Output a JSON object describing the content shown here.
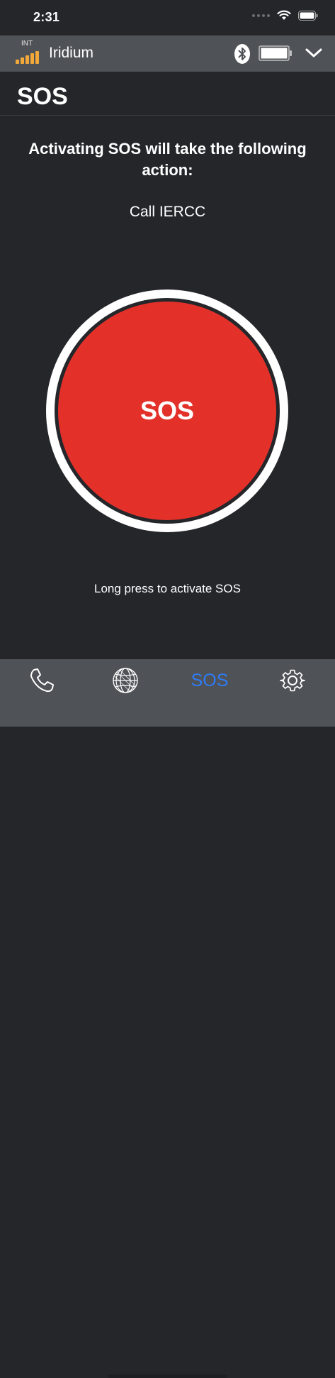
{
  "status_bar": {
    "time": "2:31"
  },
  "device_bar": {
    "network_tag": "INT",
    "network_name": "Iridium",
    "signal_color": "#f3a93a",
    "signal_bars": 5,
    "icons": [
      "signal-bars-icon",
      "bluetooth-icon",
      "battery-icon",
      "chevron-down-icon"
    ]
  },
  "page": {
    "title": "SOS",
    "headline": "Activating SOS will take the following action:",
    "action": "Call IERCC",
    "sos_button_label": "SOS",
    "hint": "Long press to activate SOS"
  },
  "tab_bar": {
    "tabs": [
      {
        "icon": "phone-icon",
        "label": ""
      },
      {
        "icon": "globe-icon",
        "label": ""
      },
      {
        "icon": "",
        "label": "SOS"
      },
      {
        "icon": "gear-icon",
        "label": ""
      }
    ],
    "active_index": 2
  },
  "colors": {
    "background": "#24262a",
    "bar": "#4f5256",
    "sos_red": "#e3312a",
    "active_tab": "#2f7cf6"
  }
}
